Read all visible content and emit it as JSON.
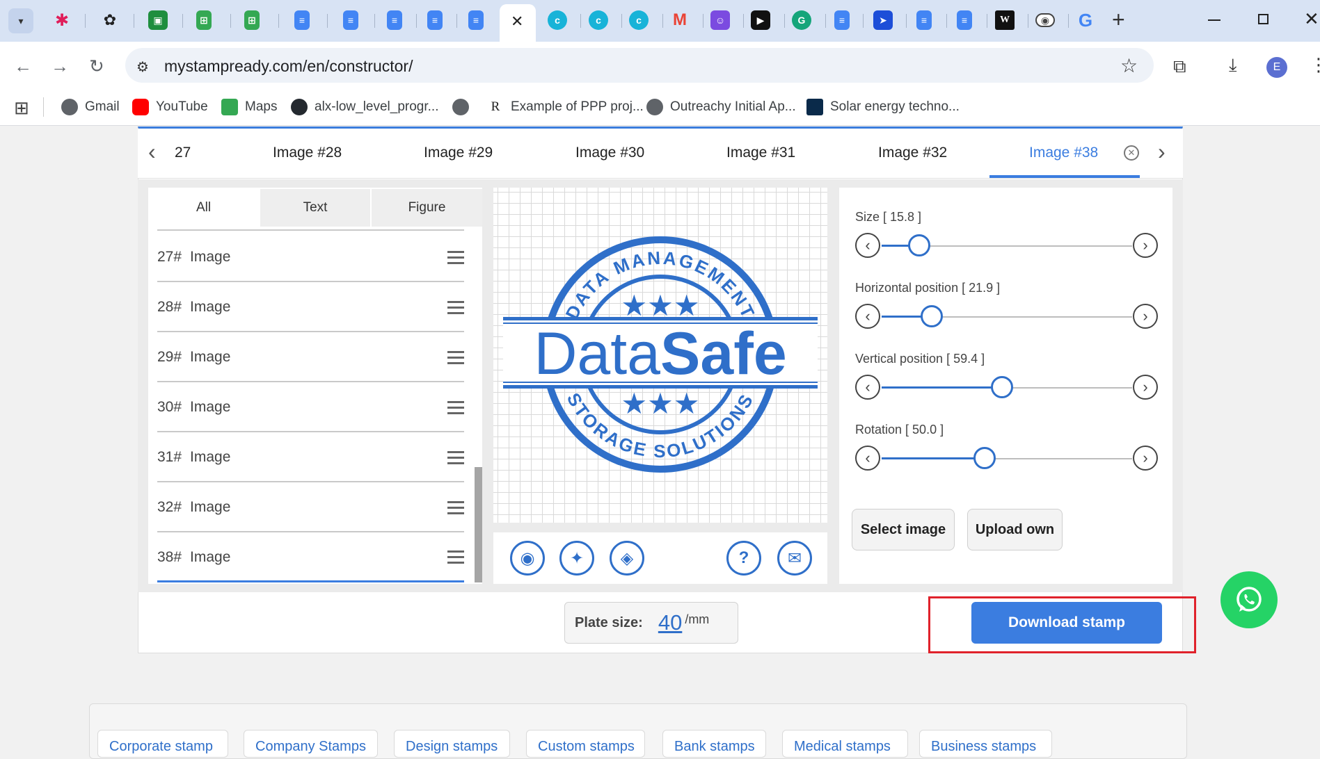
{
  "browser": {
    "url": "mystampready.com/en/constructor/",
    "profile_initial": "E",
    "close_tab_symbol": "✕",
    "bookmarks": [
      {
        "label": "Gmail",
        "icon": "globe-icon"
      },
      {
        "label": "YouTube",
        "icon": "youtube-icon"
      },
      {
        "label": "Maps",
        "icon": "maps-icon"
      },
      {
        "label": "alx-low_level_progr...",
        "icon": "github-icon"
      },
      {
        "label": "",
        "icon": "globe-icon"
      },
      {
        "label": "Example of PPP proj...",
        "icon": "rg-icon"
      },
      {
        "label": "Outreachy Initial Ap...",
        "icon": "globe-icon"
      },
      {
        "label": "Solar energy techno...",
        "icon": "dark-square-icon"
      }
    ]
  },
  "editor": {
    "image_tabs": [
      "27",
      "Image #28",
      "Image #29",
      "Image #30",
      "Image #31",
      "Image #32",
      "Image #38"
    ],
    "active_tab": "Image #38",
    "filter_tabs": [
      "All",
      "Text",
      "Figure"
    ],
    "active_filter": "All",
    "layers": [
      {
        "num": "27#",
        "label": "Image"
      },
      {
        "num": "28#",
        "label": "Image"
      },
      {
        "num": "29#",
        "label": "Image"
      },
      {
        "num": "30#",
        "label": "Image"
      },
      {
        "num": "31#",
        "label": "Image"
      },
      {
        "num": "32#",
        "label": "Image"
      },
      {
        "num": "38#",
        "label": "Image"
      }
    ],
    "stamp": {
      "top_arc": "DATA MANAGEMENT",
      "brand_light": "Data",
      "brand_bold": "Safe",
      "bottom_arc": "STORAGE SOLUTIONS",
      "color": "#2f6fc9"
    },
    "sliders": [
      {
        "label": "Size [ 15.8 ]",
        "fraction": 0.15
      },
      {
        "label": "Horizontal position [ 21.9 ]",
        "fraction": 0.2
      },
      {
        "label": "Vertical position [ 59.4 ]",
        "fraction": 0.48
      },
      {
        "label": "Rotation [ 50.0 ]",
        "fraction": 0.41
      }
    ],
    "select_image_label": "Select image",
    "upload_own_label": "Upload own",
    "plate_size_label": "Plate size:",
    "plate_size_value": "40",
    "plate_size_unit": "/mm",
    "download_label": "Download stamp"
  },
  "categories": [
    "Corporate stamp",
    "Company Stamps",
    "Design stamps",
    "Custom stamps",
    "Bank stamps",
    "Medical stamps",
    "Business stamps"
  ],
  "colors": {
    "accent": "#3b7de0",
    "highlight": "#e0222b",
    "whatsapp": "#25d366"
  }
}
